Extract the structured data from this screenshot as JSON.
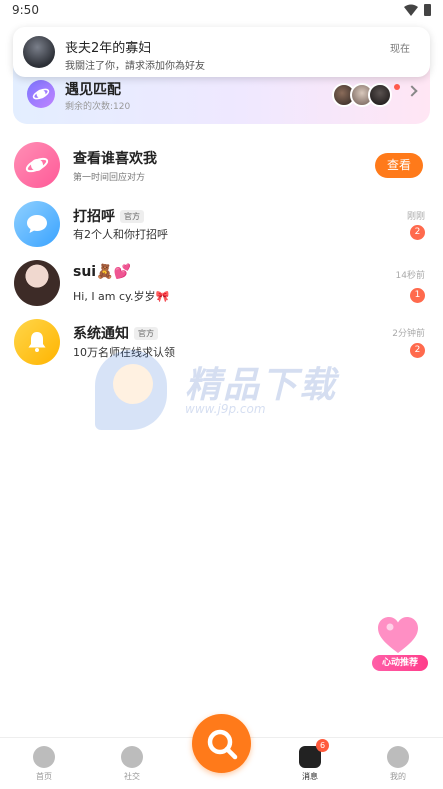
{
  "status_bar": {
    "time": "9:50"
  },
  "notification": {
    "title": "丧夫2年的寡妇",
    "message": "我關注了你，請求添加你為好友",
    "time": "现在"
  },
  "match": {
    "title": "遇见匹配",
    "remaining": "剩余的次数:120"
  },
  "who_likes": {
    "title": "查看谁喜欢我",
    "subtitle": "第一时间回应对方",
    "button": "查看"
  },
  "messages": [
    {
      "title": "打招呼",
      "tag": "官方",
      "subtitle": "有2个人和你打招呼",
      "time": "刚刚",
      "count": "2"
    },
    {
      "title": "sui🧸💕",
      "tag": "",
      "subtitle": "Hi, I am cy.岁岁🎀",
      "time": "14秒前",
      "count": "1"
    },
    {
      "title": "系统通知",
      "tag": "官方",
      "subtitle": "10万名师在线求认领",
      "time": "2分钟前",
      "count": "2"
    }
  ],
  "watermark": {
    "text": "精品下载",
    "url": "www.j9p.com"
  },
  "floating": {
    "label": "心动推荐"
  },
  "bottom_nav": {
    "items": [
      {
        "label": "首页"
      },
      {
        "label": "社交"
      },
      {
        "label": "消息",
        "badge": "6"
      },
      {
        "label": "我的"
      }
    ]
  },
  "colors": {
    "accent": "#ff7a1a",
    "badge": "#ff6a4d"
  }
}
